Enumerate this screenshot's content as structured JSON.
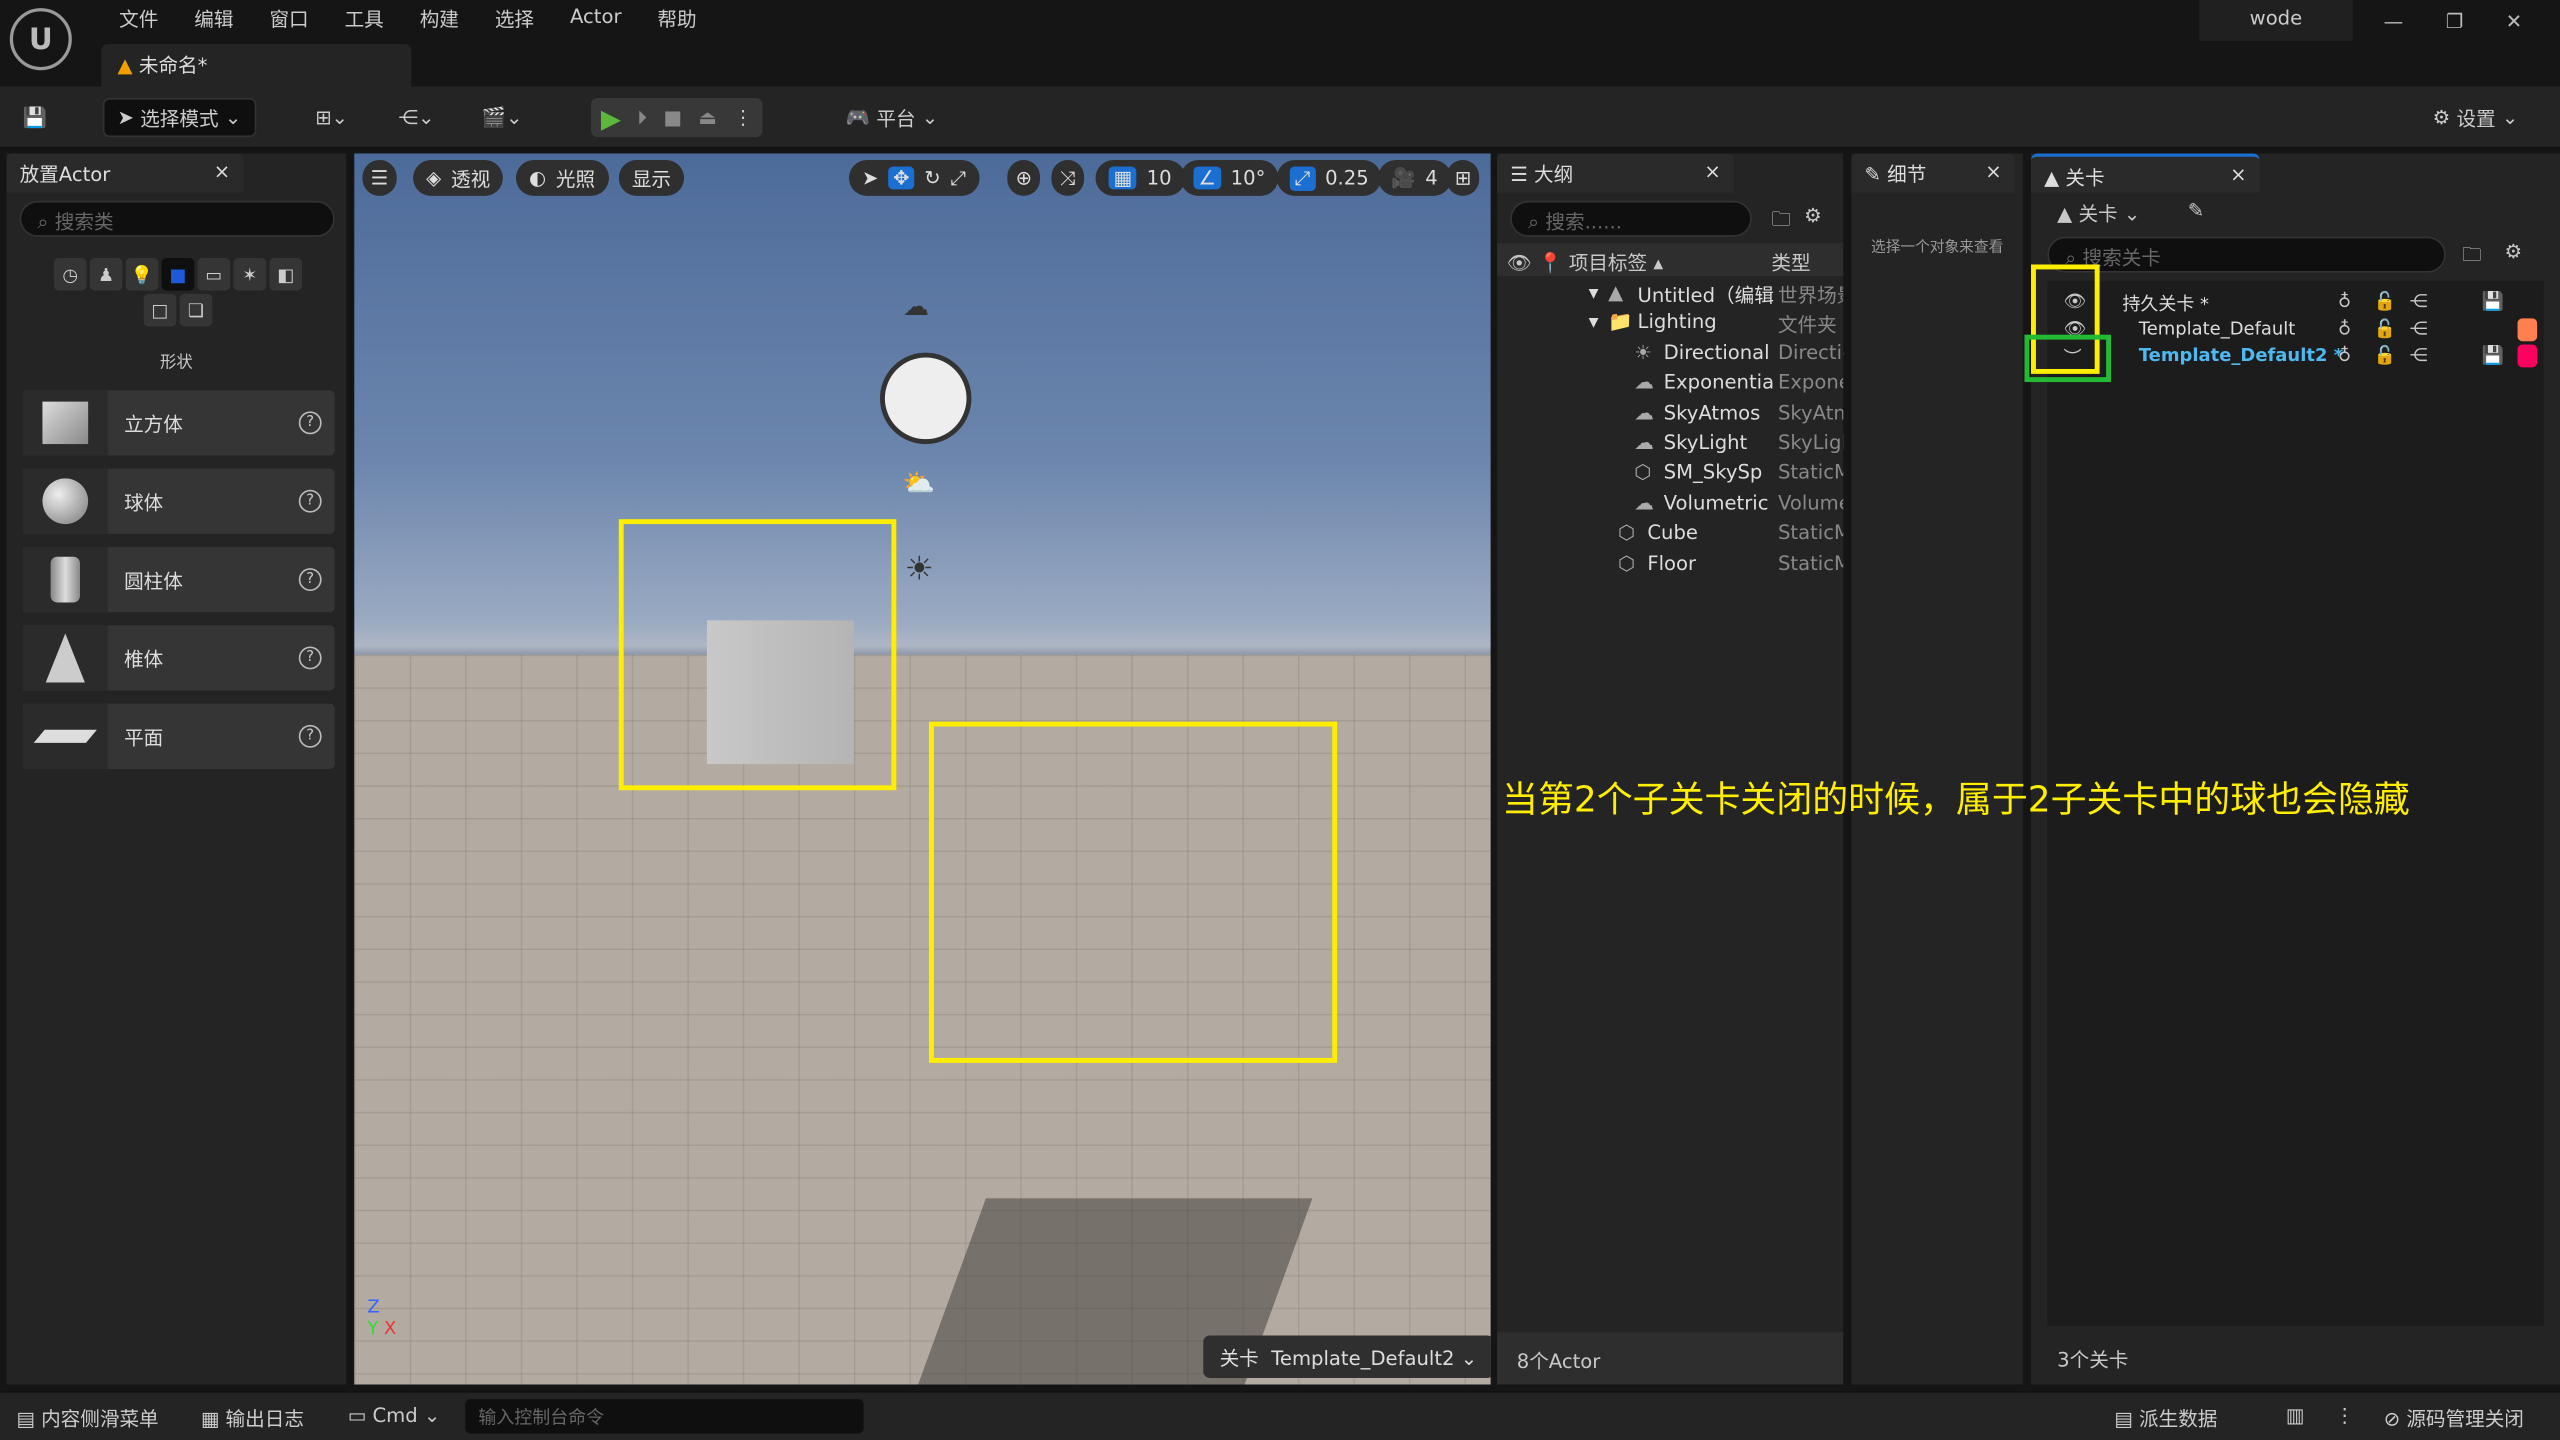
{
  "menubar": {
    "items": [
      "文件",
      "编辑",
      "窗口",
      "工具",
      "构建",
      "选择",
      "Actor",
      "帮助"
    ],
    "doc_tab": "未命名*",
    "user": "wode"
  },
  "toolbar": {
    "mode": "选择模式",
    "platform": "平台",
    "settings": "设置"
  },
  "place_actor": {
    "tab": "放置Actor",
    "search_placeholder": "搜索类",
    "category": "形状",
    "category_icons": [
      "clock-icon",
      "basic-icon",
      "light-icon",
      "shapes-icon",
      "cinematic-icon",
      "effects-icon",
      "geometry-icon",
      "volume-icon",
      "all-classes-icon"
    ],
    "shapes": [
      {
        "label": "立方体"
      },
      {
        "label": "球体"
      },
      {
        "label": "圆柱体"
      },
      {
        "label": "椎体"
      },
      {
        "label": "平面"
      }
    ]
  },
  "viewport": {
    "perspective": "透视",
    "lighting": "光照",
    "show": "显示",
    "grid_snap": "10",
    "rot_snap": "10°",
    "scale_snap": "0.25",
    "cam_speed": "4",
    "level_label": "关卡",
    "level_value": "Template_Default2",
    "annotation": "当第2个子关卡关闭的时候，属于2子关卡中的球也会隐藏",
    "highlight_color": "#ffee00"
  },
  "outliner": {
    "tab": "大纲",
    "search_placeholder": "搜索......",
    "col_label": "项目标签",
    "col_type": "类型",
    "footer": "8个Actor",
    "rows": [
      {
        "name": "Untitled（编辑",
        "type": "世界场景"
      },
      {
        "name": "Lighting",
        "type": "文件夹"
      },
      {
        "name": "Directional",
        "type": "Directic"
      },
      {
        "name": "Exponentia",
        "type": "Expone"
      },
      {
        "name": "SkyAtmos",
        "type": "SkyAtm"
      },
      {
        "name": "SkyLight",
        "type": "SkyLigh"
      },
      {
        "name": "SM_SkySp",
        "type": "StaticM"
      },
      {
        "name": "Volumetric",
        "type": "Volume"
      },
      {
        "name": "Cube",
        "type": "StaticM"
      },
      {
        "name": "Floor",
        "type": "StaticM"
      }
    ]
  },
  "details": {
    "tab": "细节",
    "hint": "选择一个对象来查看"
  },
  "levels": {
    "tab": "关卡",
    "menu": "关卡",
    "search_placeholder": "搜索关卡",
    "footer": "3个关卡",
    "rows": [
      {
        "name": "持久关卡 *",
        "visible": true,
        "color": ""
      },
      {
        "name": "Template_Default",
        "visible": true,
        "color": "#ff7f50"
      },
      {
        "name": "Template_Default2 *",
        "visible": false,
        "color": "#ff0060"
      }
    ],
    "box_yellow": "#ffee00",
    "box_green": "#22bb33"
  },
  "statusbar": {
    "content_drawer": "内容侧滑菜单",
    "output_log": "输出日志",
    "cmd": "Cmd",
    "console_placeholder": "输入控制台命令",
    "derived_data": "派生数据",
    "source_control": "源码管理关闭"
  }
}
